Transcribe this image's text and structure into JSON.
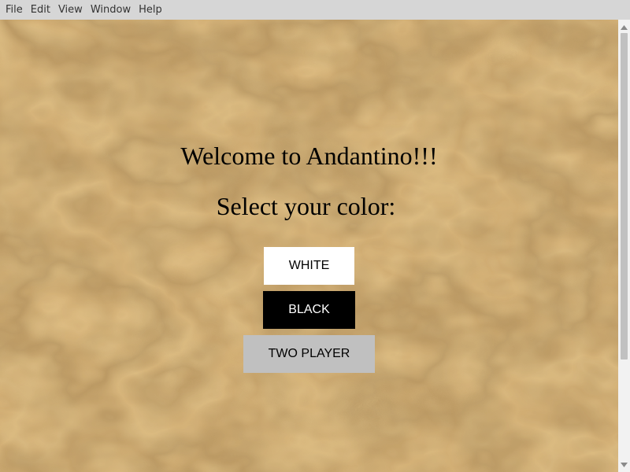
{
  "menubar": {
    "items": [
      {
        "label": "File"
      },
      {
        "label": "Edit"
      },
      {
        "label": "View"
      },
      {
        "label": "Window"
      },
      {
        "label": "Help"
      }
    ]
  },
  "main": {
    "title": "Welcome to Andantino!!!",
    "subtitle": "Select your color:",
    "buttons": {
      "white": "WHITE",
      "black": "BLACK",
      "two_player": "TWO PLAYER"
    }
  },
  "colors": {
    "background": "#d9b57a",
    "menubar": "#d6d6d6",
    "white_button": "#ffffff",
    "black_button": "#000000",
    "two_player_button": "#c0c0c0"
  },
  "icons": {
    "scroll_up": "triangle-up-icon",
    "scroll_down": "triangle-down-icon"
  }
}
